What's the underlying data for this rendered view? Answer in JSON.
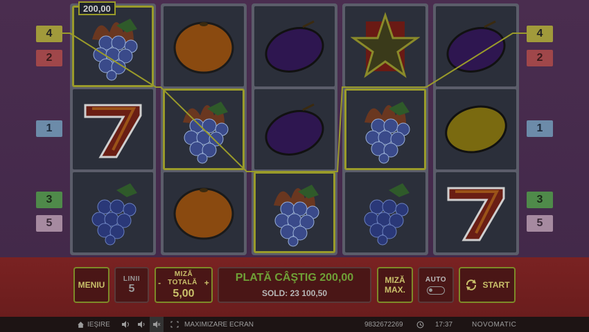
{
  "win_tag": "200,00",
  "left_lines": [
    "4",
    "2",
    "1",
    "3",
    "5"
  ],
  "right_lines": [
    "4",
    "2",
    "1",
    "3",
    "5"
  ],
  "reels": [
    [
      "grapes-burning",
      "seven",
      "grapes"
    ],
    [
      "orange",
      "grapes-burning",
      "orange"
    ],
    [
      "plum",
      "plum",
      "grapes-burning"
    ],
    [
      "star",
      "grapes-burning",
      "grapes"
    ],
    [
      "plum",
      "lemon",
      "seven"
    ]
  ],
  "controls": {
    "menu": "MENIU",
    "lines_label": "LINII",
    "lines_value": "5",
    "bet_label_1": "MIZĂ",
    "bet_label_2": "TOTALĂ",
    "bet_minus": "-",
    "bet_plus": "+",
    "bet_value": "5,00",
    "payout_label": "PLATĂ CÂŞTIG 200,00",
    "balance_label": "SOLD: 23 100,50",
    "max_bet_1": "MIZĂ",
    "max_bet_2": "MAX.",
    "auto_label": "AUTO",
    "start_label": "START"
  },
  "statusbar": {
    "exit": "IEŞIRE",
    "maximize": "MAXIMIZARE ECRAN",
    "session_id": "9832672269",
    "time": "17:37",
    "brand": "NOVOMATIC"
  },
  "colors": {
    "accent": "#9a9b2a",
    "control_bg": "#4a1616",
    "bar_bg": "#7a2222"
  }
}
